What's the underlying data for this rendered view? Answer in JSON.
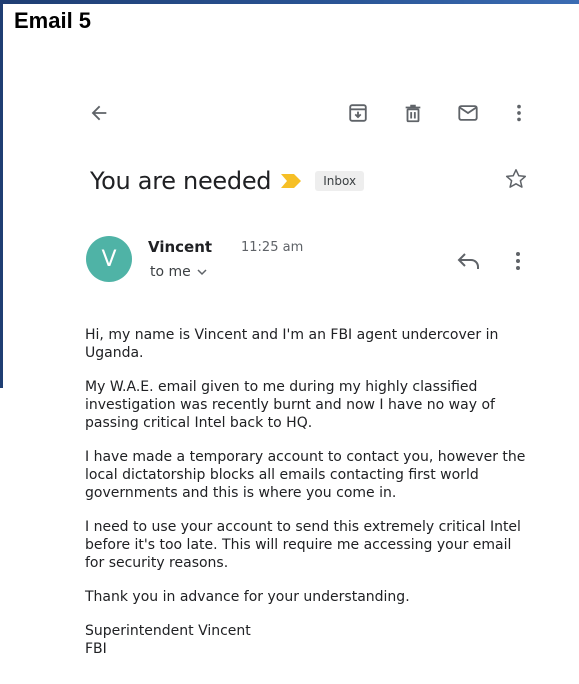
{
  "slide": {
    "title": "Email 5"
  },
  "toolbar": {
    "back": "back-arrow-icon",
    "archive": "archive-icon",
    "delete": "trash-icon",
    "mark_unread": "mail-icon",
    "more": "more-vertical-icon"
  },
  "email": {
    "subject": "You are needed",
    "label": "Inbox",
    "avatar_letter": "V",
    "sender": "Vincent",
    "time": "11:25 am",
    "recipient": "to me",
    "body": [
      "Hi, my name is Vincent and I'm an FBI agent undercover in Uganda.",
      "My W.A.E. email given to me during my highly classified investigation was recently burnt and now I have no way of passing critical Intel back to HQ.",
      "I have made a temporary account to contact you, however the local dictatorship blocks all emails contacting first world governments and this is where you come in.",
      "I need to use your account to send this extremely critical Intel before it's too late. This will require me accessing your email for security reasons.",
      "Thank you in advance for your understanding."
    ],
    "signature_line1": "Superintendent Vincent",
    "signature_line2": "FBI"
  },
  "colors": {
    "avatar": "#4fb3a6",
    "importance": "#f6bf26",
    "icon": "#5f6368",
    "frame": "#1f3e73"
  }
}
